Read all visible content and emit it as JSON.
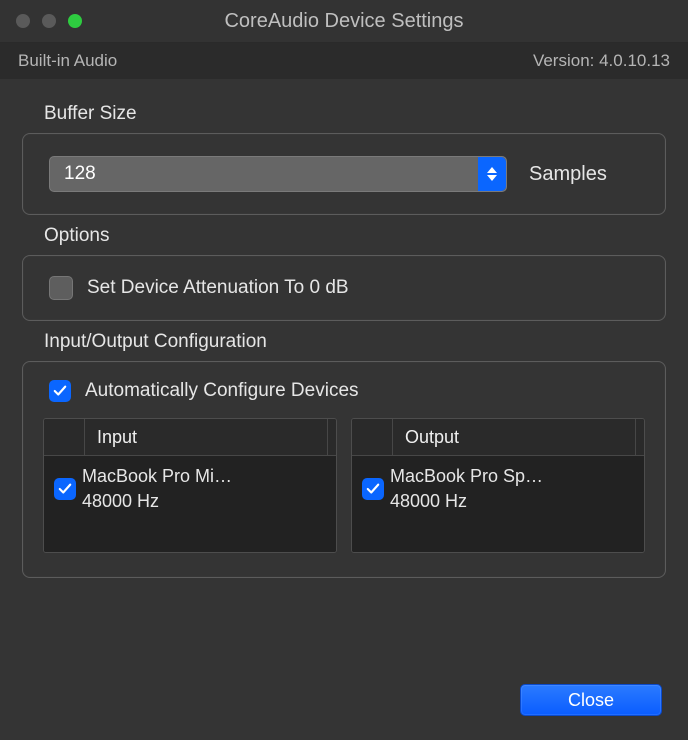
{
  "window": {
    "title": "CoreAudio Device Settings"
  },
  "subbar": {
    "device_name": "Built-in Audio",
    "version_label": "Version: 4.0.10.13"
  },
  "buffer": {
    "label": "Buffer Size",
    "value": "128",
    "unit_label": "Samples"
  },
  "options": {
    "label": "Options",
    "attenuation_label": "Set Device Attenuation To 0 dB"
  },
  "io": {
    "label": "Input/Output Configuration",
    "auto_label": "Automatically Configure Devices",
    "input": {
      "header": "Input",
      "device": "MacBook Pro Mi…",
      "rate": "48000 Hz"
    },
    "output": {
      "header": "Output",
      "device": "MacBook Pro Sp…",
      "rate": "48000 Hz"
    }
  },
  "footer": {
    "close_label": "Close"
  }
}
